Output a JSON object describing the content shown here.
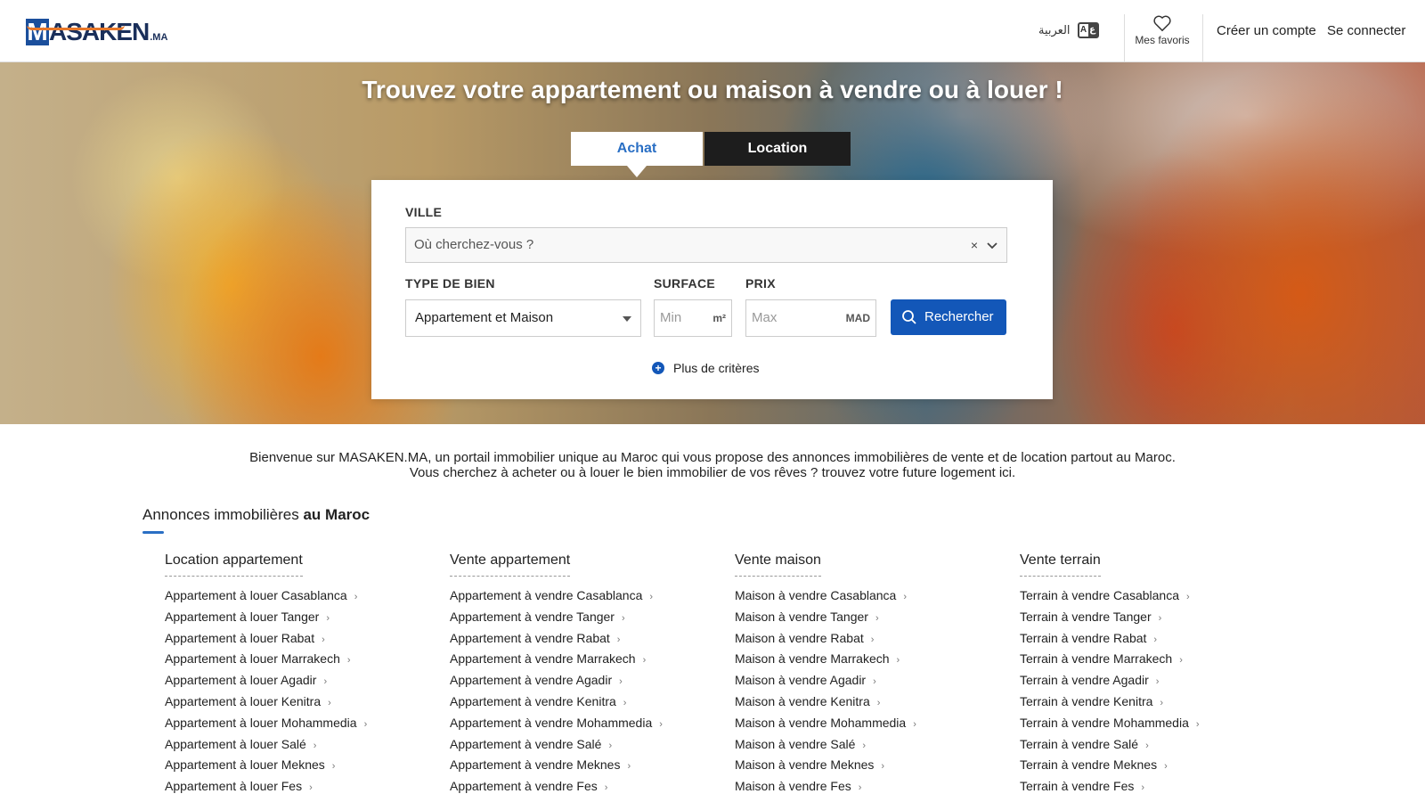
{
  "header": {
    "logo": {
      "m": "M",
      "rest": "ASAKEN",
      "suffix": ".MA"
    },
    "lang_label": "العربية",
    "lang_icon_left": "A",
    "lang_icon_right": "ع",
    "favorites_label": "Mes favoris",
    "create_account": "Créer un compte",
    "login": "Se connecter"
  },
  "hero": {
    "title": "Trouvez votre appartement ou maison à vendre ou à louer !",
    "tabs": [
      {
        "label": "Achat",
        "active": true
      },
      {
        "label": "Location",
        "active": false
      }
    ]
  },
  "search": {
    "ville_label": "VILLE",
    "ville_placeholder": "Où cherchez-vous ?",
    "clear": "×",
    "type_label": "TYPE DE BIEN",
    "type_value": "Appartement et Maison",
    "surface_label": "SURFACE",
    "surface_placeholder": "Min",
    "surface_unit": "m²",
    "prix_label": "PRIX",
    "prix_placeholder": "Max",
    "prix_unit": "MAD",
    "search_button": "Rechercher",
    "more_criteria": "Plus de critères"
  },
  "intro": {
    "line1": "Bienvenue sur MASAKEN.MA, un portail immobilier unique au Maroc qui vous propose des annonces immobilières de vente et de location partout au Maroc.",
    "line2": "Vous cherchez à acheter ou à louer le bien immobilier de vos rêves ? trouvez votre future logement ici."
  },
  "section": {
    "title_start": "Annonces immobilières ",
    "title_bold": "au Maroc"
  },
  "columns": [
    {
      "heading": "Location appartement",
      "items": [
        "Appartement à louer Casablanca",
        "Appartement à louer Tanger",
        "Appartement à louer Rabat",
        "Appartement à louer Marrakech",
        "Appartement à louer Agadir",
        "Appartement à louer Kenitra",
        "Appartement à louer Mohammedia",
        "Appartement à louer Salé",
        "Appartement à louer Meknes",
        "Appartement à louer Fes"
      ]
    },
    {
      "heading": "Vente appartement",
      "items": [
        "Appartement à vendre Casablanca",
        "Appartement à vendre Tanger",
        "Appartement à vendre Rabat",
        "Appartement à vendre Marrakech",
        "Appartement à vendre Agadir",
        "Appartement à vendre Kenitra",
        "Appartement à vendre Mohammedia",
        "Appartement à vendre Salé",
        "Appartement à vendre Meknes",
        "Appartement à vendre Fes"
      ]
    },
    {
      "heading": "Vente maison",
      "items": [
        "Maison à vendre Casablanca",
        "Maison à vendre Tanger",
        "Maison à vendre Rabat",
        "Maison à vendre Marrakech",
        "Maison à vendre Agadir",
        "Maison à vendre Kenitra",
        "Maison à vendre Mohammedia",
        "Maison à vendre Salé",
        "Maison à vendre Meknes",
        "Maison à vendre Fes"
      ]
    },
    {
      "heading": "Vente terrain",
      "items": [
        "Terrain à vendre Casablanca",
        "Terrain à vendre Tanger",
        "Terrain à vendre Rabat",
        "Terrain à vendre Marrakech",
        "Terrain à vendre Agadir",
        "Terrain à vendre Kenitra",
        "Terrain à vendre Mohammedia",
        "Terrain à vendre Salé",
        "Terrain à vendre Meknes",
        "Terrain à vendre Fes"
      ]
    }
  ],
  "colors": {
    "brand_blue": "#1357b8",
    "accent_blue": "#2a6fc4",
    "logo_orange": "#e8782a"
  }
}
